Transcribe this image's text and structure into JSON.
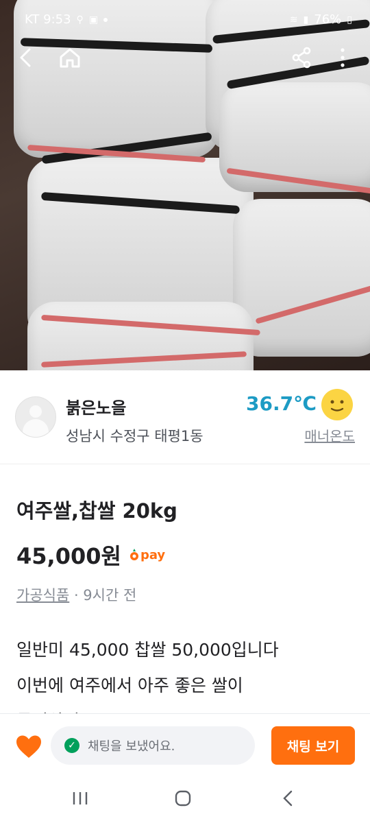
{
  "status_bar": {
    "carrier_time": "KT 9:53",
    "battery": "76%"
  },
  "seller": {
    "name": "붉은노을",
    "region": "성남시 수정구 태평1동",
    "temperature": "36.7℃",
    "manner_label": "매너온도"
  },
  "product": {
    "title": "여주쌀,찹쌀 20kg",
    "price": "45,000원",
    "pay_label": "pay",
    "category": "가공식품",
    "time": " · 9시간 전",
    "description": "일반미 45,000 찹쌀 50,000입니다\n이번에 여주에서 아주 좋은 쌀이\n들어왔어요"
  },
  "action_bar": {
    "chat_status": "채팅을 보냈어요.",
    "chat_button": "채팅 보기"
  },
  "colors": {
    "accent": "#ff6f0f",
    "temperature": "#1d9bc4",
    "success": "#00a05b"
  },
  "icons": [
    "back-icon",
    "home-icon",
    "share-icon",
    "more-icon",
    "heart-icon",
    "check-icon",
    "face-icon",
    "recents-icon",
    "home-nav-icon",
    "back-nav-icon"
  ]
}
